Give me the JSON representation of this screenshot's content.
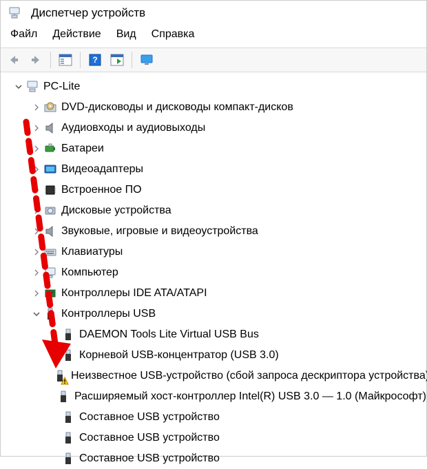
{
  "window": {
    "title": "Диспетчер устройств"
  },
  "menu": {
    "file": "Файл",
    "action": "Действие",
    "view": "Вид",
    "help": "Справка"
  },
  "tree": {
    "root": "PC-Lite",
    "items": [
      "DVD-дисководы и дисководы компакт-дисков",
      "Аудиовходы и аудиовыходы",
      "Батареи",
      "Видеоадаптеры",
      "Встроенное ПО",
      "Дисковые устройства",
      "Звуковые, игровые и видеоустройства",
      "Клавиатуры",
      "Компьютер",
      "Контроллеры IDE ATA/ATAPI",
      "Контроллеры USB"
    ],
    "usb_children": [
      "DAEMON Tools Lite Virtual USB Bus",
      "Корневой USB-концентратор (USB 3.0)",
      "Неизвестное USB-устройство (сбой запроса дескриптора устройства)",
      "Расширяемый хост-контроллер Intel(R) USB 3.0 — 1.0 (Майкрософт)",
      "Составное USB устройство",
      "Составное USB устройство",
      "Составное USB устройство"
    ]
  }
}
